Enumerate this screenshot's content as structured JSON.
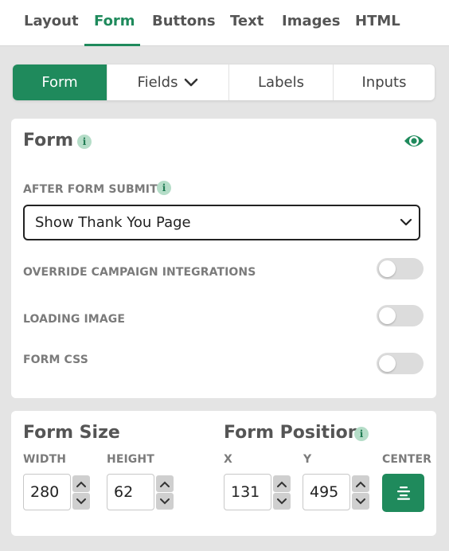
{
  "top_tabs": [
    "Layout",
    "Form",
    "Buttons",
    "Text",
    "Images",
    "HTML"
  ],
  "active_top_tab": "Form",
  "segments": [
    "Form",
    "Fields",
    "Labels",
    "Inputs"
  ],
  "active_segment": "Form",
  "form_card": {
    "title": "Form",
    "info_glyph": "i",
    "visibility_icon": "eye-icon",
    "after_submit_label": "AFTER FORM SUBMIT",
    "after_submit_value": "Show Thank You Page",
    "toggles": [
      {
        "label": "OVERRIDE CAMPAIGN INTEGRATIONS",
        "on": false
      },
      {
        "label": "LOADING IMAGE",
        "on": false
      },
      {
        "label": "FORM CSS",
        "on": false
      }
    ]
  },
  "size_card": {
    "size_title": "Form Size",
    "position_title": "Form Position",
    "width_label": "WIDTH",
    "height_label": "HEIGHT",
    "x_label": "X",
    "y_label": "Y",
    "center_label": "CENTER",
    "width_value": "280",
    "height_value": "62",
    "x_value": "131",
    "y_value": "495"
  },
  "colors": {
    "accent": "#1f8a5c",
    "info_badge": "#b5ddc8",
    "toggle_off": "#dcdcdc"
  }
}
